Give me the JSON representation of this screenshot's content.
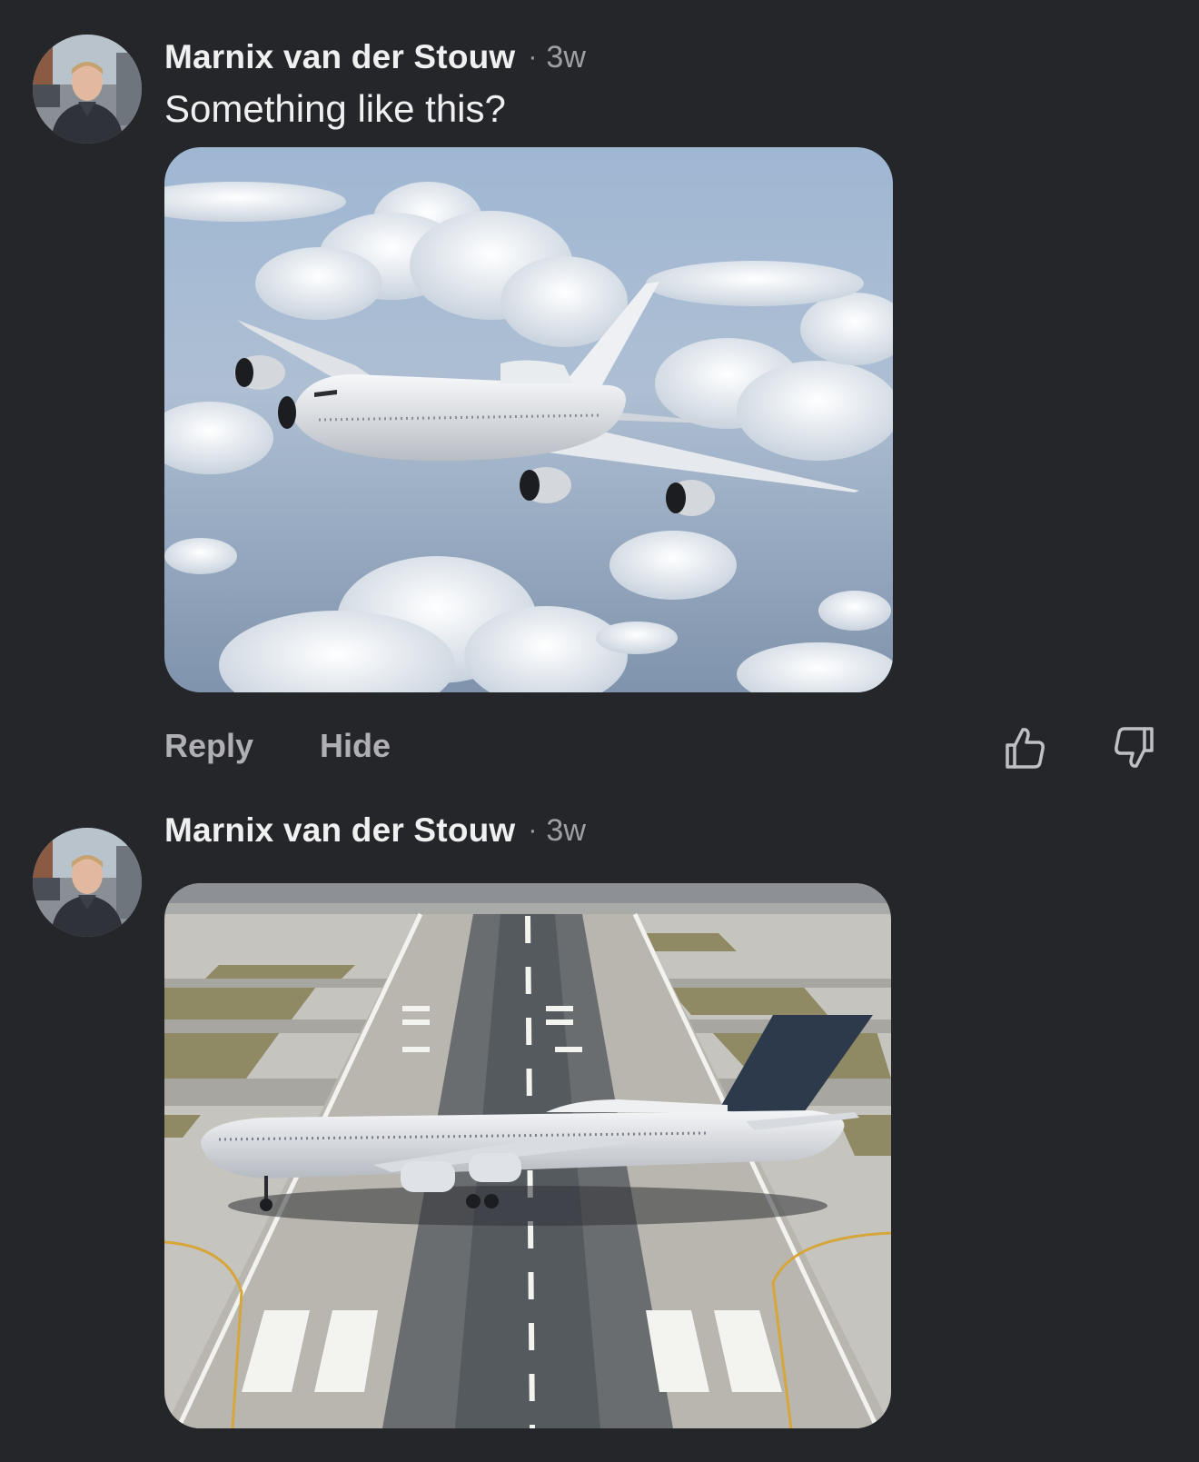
{
  "comments": [
    {
      "author": "Marnix van der Stouw",
      "separator": "·",
      "timestamp": "3w",
      "text": "Something like this?",
      "image": "airliner-above-clouds",
      "actions": {
        "reply_label": "Reply",
        "hide_label": "Hide",
        "like_icon": "thumbs-up-icon",
        "dislike_icon": "thumbs-down-icon"
      }
    },
    {
      "author": "Marnix van der Stouw",
      "separator": "·",
      "timestamp": "3w",
      "image": "airliner-on-runway"
    }
  ],
  "colors": {
    "background": "#25262a",
    "author_text": "#f0f0f0",
    "meta_text": "#a0a0a4",
    "action_text": "#b0b0b4"
  }
}
